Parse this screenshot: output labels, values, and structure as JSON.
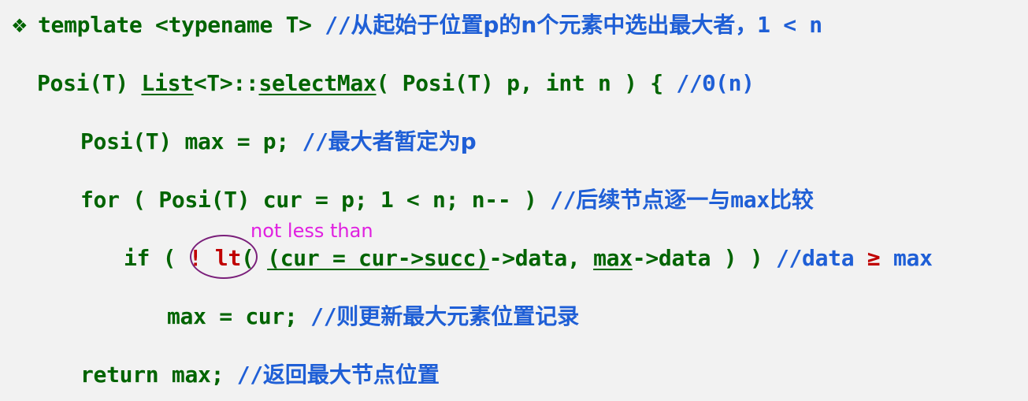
{
  "line1": {
    "bullet": "❖",
    "code": "template <typename T> ",
    "comment_slash": "//",
    "comment_cn": "从起始于位置p的n个元素中选出最大者",
    "comment_tail": "，1 < n"
  },
  "line2": {
    "ret": "Posi(T) ",
    "cls": "List",
    "tmpl": "<T>::",
    "fn": "selectMax",
    "args": "( Posi(T) p, int n ) { ",
    "comment": "//Θ(n)"
  },
  "line3": {
    "code": "Posi(T) max = p; ",
    "comment_slash": "//",
    "comment_cn": "最大者暂定为p"
  },
  "line4": {
    "code": "for ( Posi(T) cur = p; 1 < n; n-- ) ",
    "comment_slash": "//",
    "comment_cn": "后续节点逐一与",
    "comment_max": "max",
    "comment_cn2": "比较"
  },
  "line5": {
    "pre": "if ( ",
    "neg": "! lt",
    "open": "( ",
    "cur_expr": "(cur = cur->succ)",
    "mid": "->data, ",
    "max_word": "max",
    "post": "->data ) ) ",
    "comment_pre": "//data ",
    "comment_ge": "≥",
    "comment_post": " max"
  },
  "annotation": {
    "note": "not less than"
  },
  "line6": {
    "code": "max = cur; ",
    "comment_slash": "//",
    "comment_cn": "则更新最大元素位置记录"
  },
  "line7": {
    "code": "return max; ",
    "comment_slash": "//",
    "comment_cn": "返回最大节点位置"
  }
}
